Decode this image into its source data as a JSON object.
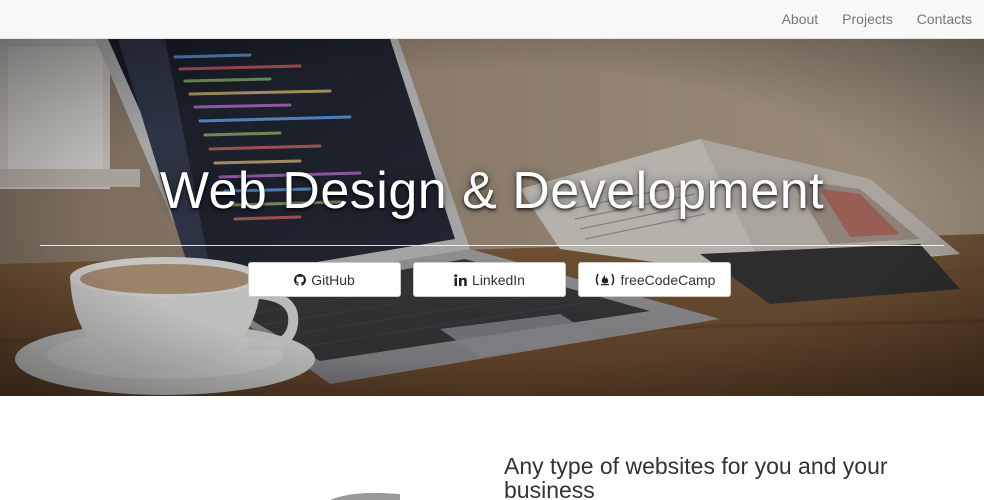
{
  "nav": {
    "items": [
      {
        "label": "About"
      },
      {
        "label": "Projects"
      },
      {
        "label": "Contacts"
      }
    ]
  },
  "hero": {
    "title": "Web Design & Development",
    "buttons": [
      {
        "label": "GitHub",
        "icon": "github-icon"
      },
      {
        "label": "LinkedIn",
        "icon": "linkedin-icon"
      },
      {
        "label": "freeCodeCamp",
        "icon": "freecodecamp-icon"
      }
    ]
  },
  "section": {
    "heading": "Any type of websites for you and your business"
  },
  "colors": {
    "navbar_bg": "#f8f8f8",
    "nav_text": "#777777",
    "hero_text": "#ffffff",
    "button_bg": "#ffffff",
    "body_text": "#333333"
  }
}
